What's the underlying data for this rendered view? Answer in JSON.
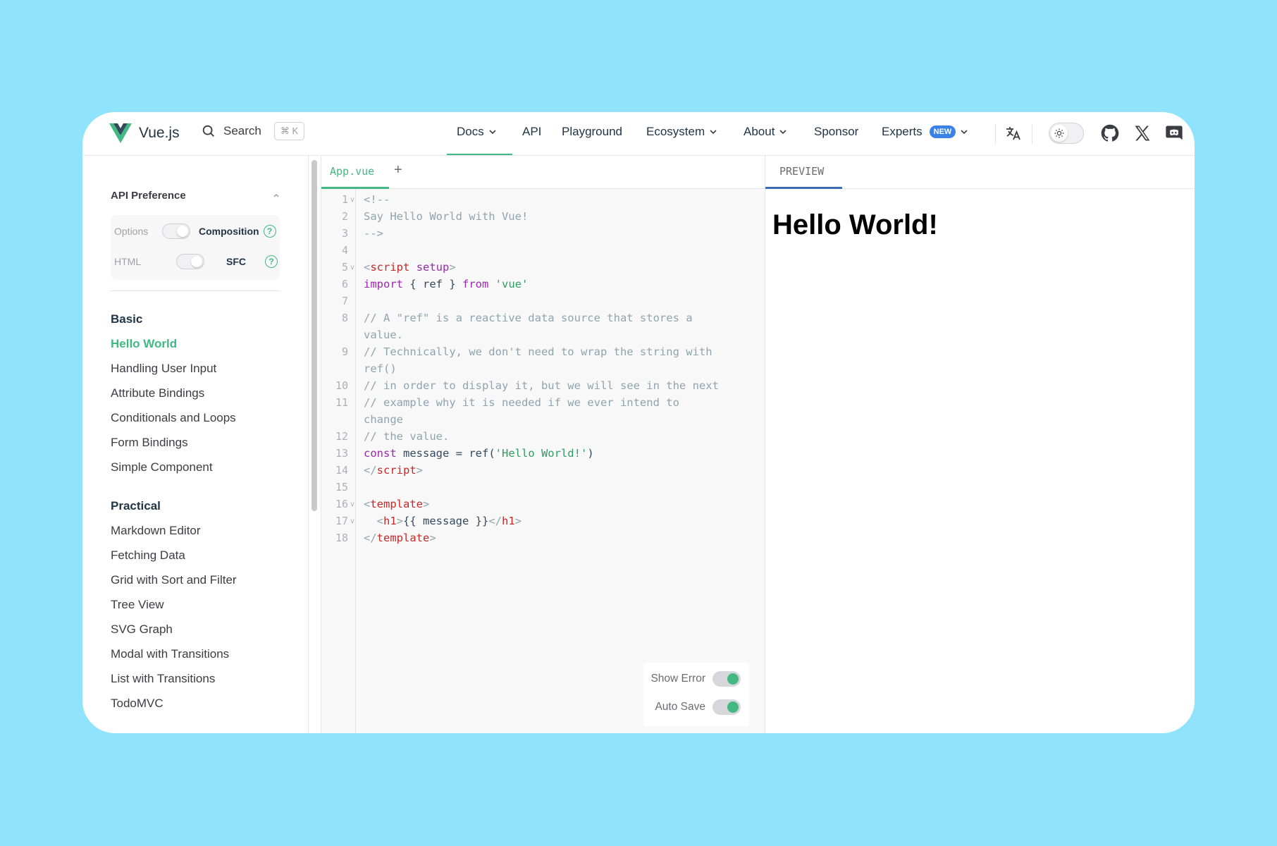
{
  "header": {
    "brand": "Vue.js",
    "search": {
      "label": "Search",
      "shortcut": "⌘ K"
    },
    "menu": [
      {
        "label": "Docs"
      },
      {
        "label": "API"
      },
      {
        "label": "Playground"
      },
      {
        "label": "Ecosystem"
      },
      {
        "label": "About"
      },
      {
        "label": "Sponsor"
      },
      {
        "label": "Experts",
        "badge": "NEW"
      }
    ],
    "colors": {
      "accent": "#42b883",
      "badge": "#3a82e8"
    }
  },
  "sidebar": {
    "preference_title": "API Preference",
    "options_label": "Options",
    "composition_label": "Composition",
    "html_label": "HTML",
    "sfc_label": "SFC",
    "help_glyph": "?",
    "groups": [
      {
        "title": "Basic",
        "items": [
          "Hello World",
          "Handling User Input",
          "Attribute Bindings",
          "Conditionals and Loops",
          "Form Bindings",
          "Simple Component"
        ]
      },
      {
        "title": "Practical",
        "items": [
          "Markdown Editor",
          "Fetching Data",
          "Grid with Sort and Filter",
          "Tree View",
          "SVG Graph",
          "Modal with Transitions",
          "List with Transitions",
          "TodoMVC"
        ]
      }
    ],
    "active_item": "Hello World"
  },
  "editor": {
    "tab": "App.vue",
    "add_tab": "+",
    "line_numbers": [
      "1",
      "2",
      "3",
      "4",
      "5",
      "6",
      "7",
      "8",
      "9",
      "10",
      "11",
      "12",
      "13",
      "14",
      "15",
      "16",
      "17",
      "18"
    ],
    "fold_marker": "v",
    "show_error_label": "Show Error",
    "auto_save_label": "Auto Save"
  },
  "preview": {
    "tab": "PREVIEW",
    "heading": "Hello World!"
  }
}
